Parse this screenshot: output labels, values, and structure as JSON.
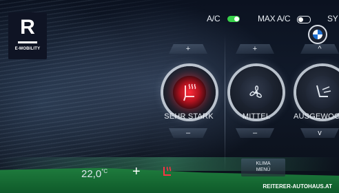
{
  "brand": {
    "logo_letter": "R",
    "logo_caption": "E-MOBILITY",
    "website": "REITERER-AUTOHAUS.AT"
  },
  "topbar": {
    "ac_label": "A/C",
    "ac_on": true,
    "max_ac_label": "MAX A/C",
    "max_ac_on": false,
    "sync_label": "SY",
    "toggle_on_color": "#37d14a",
    "bmw_logo_icon": "bmw-roundel-icon"
  },
  "seat_heating": {
    "plus_label": "+",
    "minus_label": "–",
    "level_label": "SEHR STARK",
    "icon": "seat-heating-icon",
    "accent_color": "#e0222f"
  },
  "fan": {
    "plus_label": "+",
    "minus_label": "–",
    "level_label": "MITTEL",
    "icon": "fan-icon"
  },
  "air_distribution": {
    "up_label": "^",
    "down_label": "v",
    "level_label": "AUSGEWOGEN",
    "icon": "seat-airflow-icon"
  },
  "bottom": {
    "temperature": "22,0",
    "unit": "°C",
    "plus_label": "+",
    "klima_label_1": "KLIMA",
    "klima_label_2": "MENÜ"
  }
}
